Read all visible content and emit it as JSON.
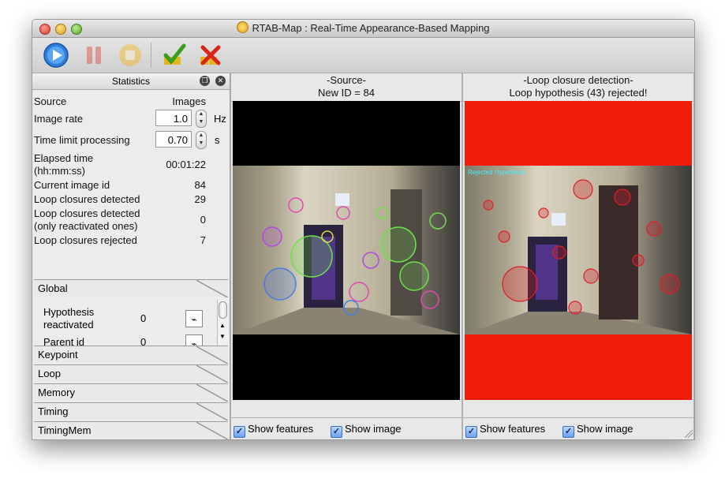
{
  "window": {
    "title": "RTAB-Map : Real-Time Appearance-Based Mapping"
  },
  "toolbar": {
    "buttons": [
      {
        "name": "start",
        "icon": "play-icon"
      },
      {
        "name": "pause",
        "icon": "pause-icon"
      },
      {
        "name": "stop",
        "icon": "stop-icon"
      },
      {
        "name": "accept",
        "icon": "check-icon"
      },
      {
        "name": "reject",
        "icon": "x-icon"
      }
    ]
  },
  "statistics": {
    "title": "Statistics",
    "source_label": "Source",
    "source_value": "Images",
    "image_rate_label": "Image rate",
    "image_rate_value": "1.0",
    "image_rate_unit": "Hz",
    "time_limit_label": "Time limit processing",
    "time_limit_value": "0.70",
    "time_limit_unit": "s",
    "elapsed_label": "Elapsed time",
    "elapsed_label_2": "(hh:mm:ss)",
    "elapsed_value": "00:01:22",
    "current_id_label": "Current image id",
    "current_id_value": "84",
    "loops_detected_label": "Loop closures detected",
    "loops_detected_value": "29",
    "loops_reactivated_label": "Loop closures detected",
    "loops_reactivated_label_2": "(only reactivated ones)",
    "loops_reactivated_value": "0",
    "loops_rejected_label": "Loop closures rejected",
    "loops_rejected_value": "7",
    "tabs": [
      "Global",
      "Keypoint",
      "Loop",
      "Memory",
      "Timing",
      "TimingMem"
    ],
    "global_rows": [
      {
        "label": "Hypothesis",
        "label_2": "reactivated",
        "value": "0"
      },
      {
        "label": "Parent id",
        "value": "0"
      }
    ]
  },
  "source_panel": {
    "title": "-Source-",
    "subtitle": "New ID = 84",
    "show_features": "Show features",
    "show_image": "Show image"
  },
  "loop_panel": {
    "title": "-Loop closure detection-",
    "subtitle": "Loop hypothesis (43) rejected!",
    "overlay_text": "Rejected Hypothesis",
    "show_features": "Show features",
    "show_image": "Show image",
    "background_color": "#f21c0a"
  },
  "colors": {
    "accent": "#3b7fd9",
    "reject": "#f21c0a"
  }
}
